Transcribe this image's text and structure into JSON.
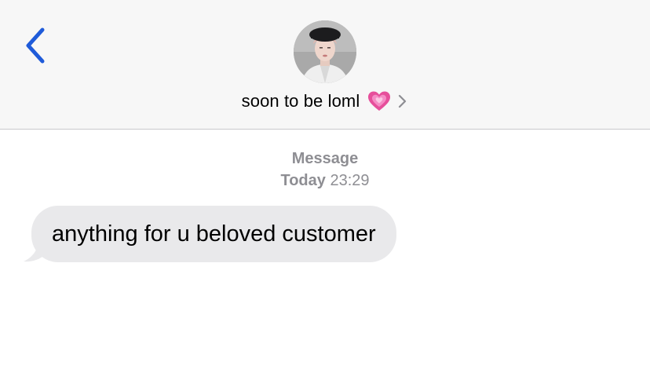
{
  "header": {
    "back_icon": "chevron-left-icon",
    "contact_name": "soon to be loml",
    "contact_emoji": "growing-heart-icon",
    "disclosure_icon": "chevron-right-icon",
    "accent_color": "#1f5bd9"
  },
  "thread": {
    "service": "Message",
    "day": "Today",
    "time": "23:29",
    "messages": [
      {
        "direction": "incoming",
        "text": "anything for u beloved customer"
      }
    ]
  },
  "colors": {
    "header_bg": "#f7f7f7",
    "incoming_bubble": "#e9e9eb",
    "meta_text": "#8e8e93"
  }
}
